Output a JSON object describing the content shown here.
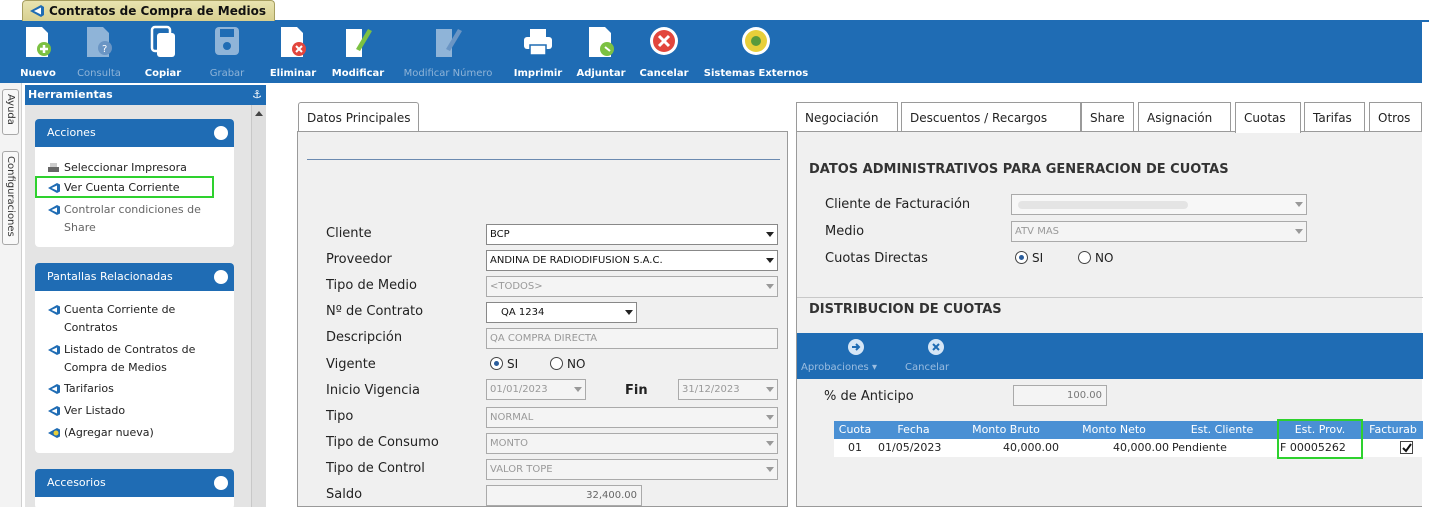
{
  "window": {
    "doc_tab": "Contratos de Compra de Medios"
  },
  "toolbar": {
    "items": [
      {
        "label": "Nuevo",
        "icon": "new-doc-icon",
        "enabled": true
      },
      {
        "label": "Consulta",
        "icon": "search-doc-icon",
        "enabled": false
      },
      {
        "label": "Copiar",
        "icon": "copy-icon",
        "enabled": true
      },
      {
        "label": "Grabar",
        "icon": "save-icon",
        "enabled": false
      },
      {
        "label": "Eliminar",
        "icon": "delete-doc-icon",
        "enabled": true
      },
      {
        "label": "Modificar",
        "icon": "edit-icon",
        "enabled": true
      },
      {
        "label": "Modificar Número",
        "icon": "edit-number-icon",
        "enabled": false
      },
      {
        "label": "Imprimir",
        "icon": "printer-icon",
        "enabled": true
      },
      {
        "label": "Adjuntar",
        "icon": "attach-icon",
        "enabled": true
      },
      {
        "label": "Cancelar",
        "icon": "cancel-icon",
        "enabled": true
      },
      {
        "label": "Sistemas Externos",
        "icon": "external-systems-icon",
        "enabled": true
      }
    ]
  },
  "side_tabs": {
    "help": "Ayuda",
    "config": "Configuraciones"
  },
  "tools": {
    "header": "Herramientas",
    "acciones": {
      "title": "Acciones",
      "items": [
        "Seleccionar Impresora",
        "Ver Cuenta Corriente",
        "Controlar condiciones de Share"
      ]
    },
    "relacionadas": {
      "title": "Pantallas Relacionadas",
      "items": [
        "Cuenta Corriente de Contratos",
        "Listado de Contratos de Compra de Medios",
        "Tarifarios",
        "Ver Listado",
        "(Agregar nueva)"
      ]
    },
    "accesorios": {
      "title": "Accesorios"
    }
  },
  "main": {
    "tab": "Datos Principales",
    "fields": {
      "cliente": {
        "label": "Cliente",
        "value": "BCP"
      },
      "proveedor": {
        "label": "Proveedor",
        "value": "ANDINA DE RADIODIFUSION S.A.C."
      },
      "tipo_medio": {
        "label": "Tipo de Medio",
        "value": "<TODOS>"
      },
      "contrato": {
        "label": "Nº de Contrato",
        "value": "QA 1234"
      },
      "descripcion": {
        "label": "Descripción",
        "value": "QA COMPRA DIRECTA"
      },
      "vigente": {
        "label": "Vigente",
        "si": "SI",
        "no": "NO",
        "selected": "SI"
      },
      "inicio": {
        "label": "Inicio Vigencia",
        "value": "01/01/2023"
      },
      "fin": {
        "label": "Fin",
        "value": "31/12/2023"
      },
      "tipo": {
        "label": "Tipo",
        "value": "NORMAL"
      },
      "consumo": {
        "label": "Tipo de Consumo",
        "value": "MONTO"
      },
      "control": {
        "label": "Tipo de Control",
        "value": "VALOR TOPE"
      },
      "saldo": {
        "label": "Saldo",
        "value": "32,400.00"
      }
    }
  },
  "right": {
    "tabs": [
      "Negociación",
      "Descuentos / Recargos",
      "Share",
      "Asignación",
      "Cuotas",
      "Tarifas",
      "Otros"
    ],
    "selected_tab": "Cuotas",
    "admin_title": "DATOS ADMINISTRATIVOS PARA GENERACION DE CUOTAS",
    "cliente_fact_label": "Cliente de Facturación",
    "cliente_fact_value": "",
    "medio_label": "Medio",
    "medio_value": "ATV MAS",
    "cuotas_directas_label": "Cuotas Directas",
    "cuotas_si": "SI",
    "cuotas_no": "NO",
    "dist_title": "DISTRIBUCION DE CUOTAS",
    "aprobaciones": "Aprobaciones",
    "cancelar": "Cancelar",
    "anticipo_label": "% de Anticipo",
    "anticipo_value": "100.00",
    "grid": {
      "columns": [
        "Cuota",
        "Fecha",
        "Monto Bruto",
        "Monto Neto",
        "Est. Cliente",
        "Est. Prov.",
        "Facturab"
      ],
      "rows": [
        {
          "cuota": "01",
          "fecha": "01/05/2023",
          "bruto": "40,000.00",
          "neto": "40,000.00",
          "est_cliente": "Pendiente",
          "est_prov": "F 00005262",
          "facturable": true
        }
      ]
    }
  },
  "colors": {
    "toolbar": "#1f6cb4",
    "highlight": "#2ed12e",
    "grid_header": "#4a90d4"
  }
}
